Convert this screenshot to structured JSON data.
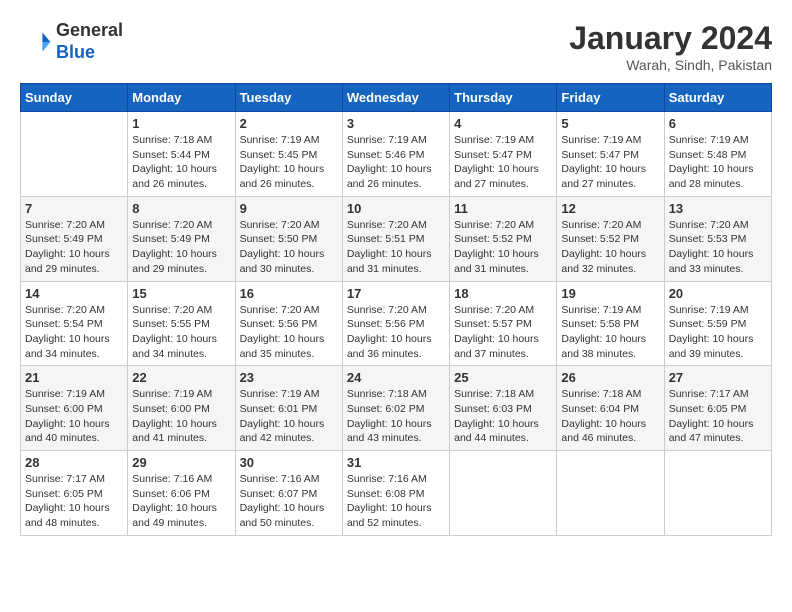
{
  "header": {
    "logo_line1": "General",
    "logo_line2": "Blue",
    "title": "January 2024",
    "subtitle": "Warah, Sindh, Pakistan"
  },
  "days_of_week": [
    "Sunday",
    "Monday",
    "Tuesday",
    "Wednesday",
    "Thursday",
    "Friday",
    "Saturday"
  ],
  "weeks": [
    [
      {
        "day": "",
        "sunrise": "",
        "sunset": "",
        "daylight": ""
      },
      {
        "day": "1",
        "sunrise": "Sunrise: 7:18 AM",
        "sunset": "Sunset: 5:44 PM",
        "daylight": "Daylight: 10 hours and 26 minutes."
      },
      {
        "day": "2",
        "sunrise": "Sunrise: 7:19 AM",
        "sunset": "Sunset: 5:45 PM",
        "daylight": "Daylight: 10 hours and 26 minutes."
      },
      {
        "day": "3",
        "sunrise": "Sunrise: 7:19 AM",
        "sunset": "Sunset: 5:46 PM",
        "daylight": "Daylight: 10 hours and 26 minutes."
      },
      {
        "day": "4",
        "sunrise": "Sunrise: 7:19 AM",
        "sunset": "Sunset: 5:47 PM",
        "daylight": "Daylight: 10 hours and 27 minutes."
      },
      {
        "day": "5",
        "sunrise": "Sunrise: 7:19 AM",
        "sunset": "Sunset: 5:47 PM",
        "daylight": "Daylight: 10 hours and 27 minutes."
      },
      {
        "day": "6",
        "sunrise": "Sunrise: 7:19 AM",
        "sunset": "Sunset: 5:48 PM",
        "daylight": "Daylight: 10 hours and 28 minutes."
      }
    ],
    [
      {
        "day": "7",
        "sunrise": "Sunrise: 7:20 AM",
        "sunset": "Sunset: 5:49 PM",
        "daylight": "Daylight: 10 hours and 29 minutes."
      },
      {
        "day": "8",
        "sunrise": "Sunrise: 7:20 AM",
        "sunset": "Sunset: 5:49 PM",
        "daylight": "Daylight: 10 hours and 29 minutes."
      },
      {
        "day": "9",
        "sunrise": "Sunrise: 7:20 AM",
        "sunset": "Sunset: 5:50 PM",
        "daylight": "Daylight: 10 hours and 30 minutes."
      },
      {
        "day": "10",
        "sunrise": "Sunrise: 7:20 AM",
        "sunset": "Sunset: 5:51 PM",
        "daylight": "Daylight: 10 hours and 31 minutes."
      },
      {
        "day": "11",
        "sunrise": "Sunrise: 7:20 AM",
        "sunset": "Sunset: 5:52 PM",
        "daylight": "Daylight: 10 hours and 31 minutes."
      },
      {
        "day": "12",
        "sunrise": "Sunrise: 7:20 AM",
        "sunset": "Sunset: 5:52 PM",
        "daylight": "Daylight: 10 hours and 32 minutes."
      },
      {
        "day": "13",
        "sunrise": "Sunrise: 7:20 AM",
        "sunset": "Sunset: 5:53 PM",
        "daylight": "Daylight: 10 hours and 33 minutes."
      }
    ],
    [
      {
        "day": "14",
        "sunrise": "Sunrise: 7:20 AM",
        "sunset": "Sunset: 5:54 PM",
        "daylight": "Daylight: 10 hours and 34 minutes."
      },
      {
        "day": "15",
        "sunrise": "Sunrise: 7:20 AM",
        "sunset": "Sunset: 5:55 PM",
        "daylight": "Daylight: 10 hours and 34 minutes."
      },
      {
        "day": "16",
        "sunrise": "Sunrise: 7:20 AM",
        "sunset": "Sunset: 5:56 PM",
        "daylight": "Daylight: 10 hours and 35 minutes."
      },
      {
        "day": "17",
        "sunrise": "Sunrise: 7:20 AM",
        "sunset": "Sunset: 5:56 PM",
        "daylight": "Daylight: 10 hours and 36 minutes."
      },
      {
        "day": "18",
        "sunrise": "Sunrise: 7:20 AM",
        "sunset": "Sunset: 5:57 PM",
        "daylight": "Daylight: 10 hours and 37 minutes."
      },
      {
        "day": "19",
        "sunrise": "Sunrise: 7:19 AM",
        "sunset": "Sunset: 5:58 PM",
        "daylight": "Daylight: 10 hours and 38 minutes."
      },
      {
        "day": "20",
        "sunrise": "Sunrise: 7:19 AM",
        "sunset": "Sunset: 5:59 PM",
        "daylight": "Daylight: 10 hours and 39 minutes."
      }
    ],
    [
      {
        "day": "21",
        "sunrise": "Sunrise: 7:19 AM",
        "sunset": "Sunset: 6:00 PM",
        "daylight": "Daylight: 10 hours and 40 minutes."
      },
      {
        "day": "22",
        "sunrise": "Sunrise: 7:19 AM",
        "sunset": "Sunset: 6:00 PM",
        "daylight": "Daylight: 10 hours and 41 minutes."
      },
      {
        "day": "23",
        "sunrise": "Sunrise: 7:19 AM",
        "sunset": "Sunset: 6:01 PM",
        "daylight": "Daylight: 10 hours and 42 minutes."
      },
      {
        "day": "24",
        "sunrise": "Sunrise: 7:18 AM",
        "sunset": "Sunset: 6:02 PM",
        "daylight": "Daylight: 10 hours and 43 minutes."
      },
      {
        "day": "25",
        "sunrise": "Sunrise: 7:18 AM",
        "sunset": "Sunset: 6:03 PM",
        "daylight": "Daylight: 10 hours and 44 minutes."
      },
      {
        "day": "26",
        "sunrise": "Sunrise: 7:18 AM",
        "sunset": "Sunset: 6:04 PM",
        "daylight": "Daylight: 10 hours and 46 minutes."
      },
      {
        "day": "27",
        "sunrise": "Sunrise: 7:17 AM",
        "sunset": "Sunset: 6:05 PM",
        "daylight": "Daylight: 10 hours and 47 minutes."
      }
    ],
    [
      {
        "day": "28",
        "sunrise": "Sunrise: 7:17 AM",
        "sunset": "Sunset: 6:05 PM",
        "daylight": "Daylight: 10 hours and 48 minutes."
      },
      {
        "day": "29",
        "sunrise": "Sunrise: 7:16 AM",
        "sunset": "Sunset: 6:06 PM",
        "daylight": "Daylight: 10 hours and 49 minutes."
      },
      {
        "day": "30",
        "sunrise": "Sunrise: 7:16 AM",
        "sunset": "Sunset: 6:07 PM",
        "daylight": "Daylight: 10 hours and 50 minutes."
      },
      {
        "day": "31",
        "sunrise": "Sunrise: 7:16 AM",
        "sunset": "Sunset: 6:08 PM",
        "daylight": "Daylight: 10 hours and 52 minutes."
      },
      {
        "day": "",
        "sunrise": "",
        "sunset": "",
        "daylight": ""
      },
      {
        "day": "",
        "sunrise": "",
        "sunset": "",
        "daylight": ""
      },
      {
        "day": "",
        "sunrise": "",
        "sunset": "",
        "daylight": ""
      }
    ]
  ]
}
